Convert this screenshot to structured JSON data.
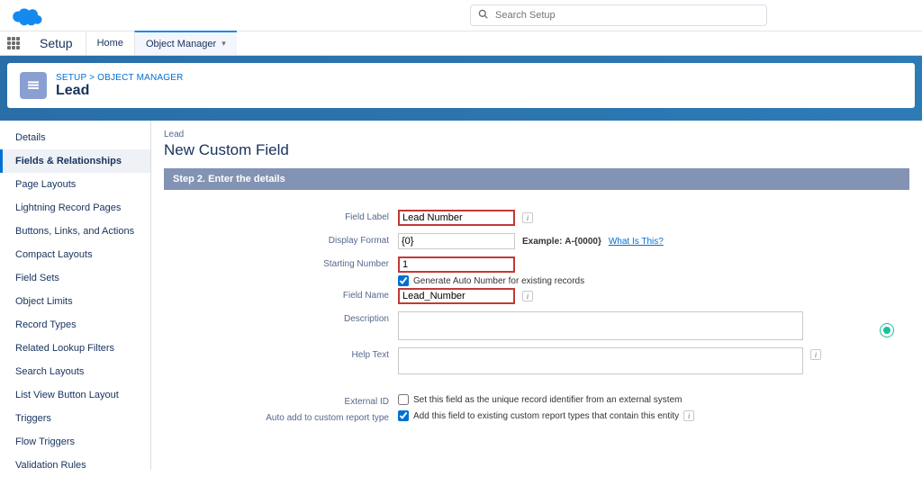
{
  "search": {
    "placeholder": "Search Setup"
  },
  "nav": {
    "app": "Setup",
    "home": "Home",
    "object_manager": "Object Manager"
  },
  "header": {
    "crumb": "SETUP > OBJECT MANAGER",
    "title": "Lead"
  },
  "sidebar": {
    "items": [
      "Details",
      "Fields & Relationships",
      "Page Layouts",
      "Lightning Record Pages",
      "Buttons, Links, and Actions",
      "Compact Layouts",
      "Field Sets",
      "Object Limits",
      "Record Types",
      "Related Lookup Filters",
      "Search Layouts",
      "List View Button Layout",
      "Triggers",
      "Flow Triggers",
      "Validation Rules"
    ],
    "active_index": 1
  },
  "page": {
    "object_mini": "Lead",
    "subtitle": "New Custom Field",
    "step_bar": "Step 2. Enter the details"
  },
  "form": {
    "field_label": {
      "label": "Field Label",
      "value": "Lead Number"
    },
    "display_format": {
      "label": "Display Format",
      "value": "{0}",
      "example_prefix": "Example:",
      "example_value": "A-{0000}",
      "what_is_this": "What Is This?"
    },
    "starting_number": {
      "label": "Starting Number",
      "value": "1",
      "generate_label": "Generate Auto Number for existing records",
      "generate_checked": true
    },
    "field_name": {
      "label": "Field Name",
      "value": "Lead_Number"
    },
    "description": {
      "label": "Description",
      "value": ""
    },
    "help_text": {
      "label": "Help Text",
      "value": ""
    },
    "external_id": {
      "label": "External ID",
      "text": "Set this field as the unique record identifier from an external system",
      "checked": false
    },
    "auto_add": {
      "label": "Auto add to custom report type",
      "text": "Add this field to existing custom report types that contain this entity",
      "checked": true
    }
  }
}
